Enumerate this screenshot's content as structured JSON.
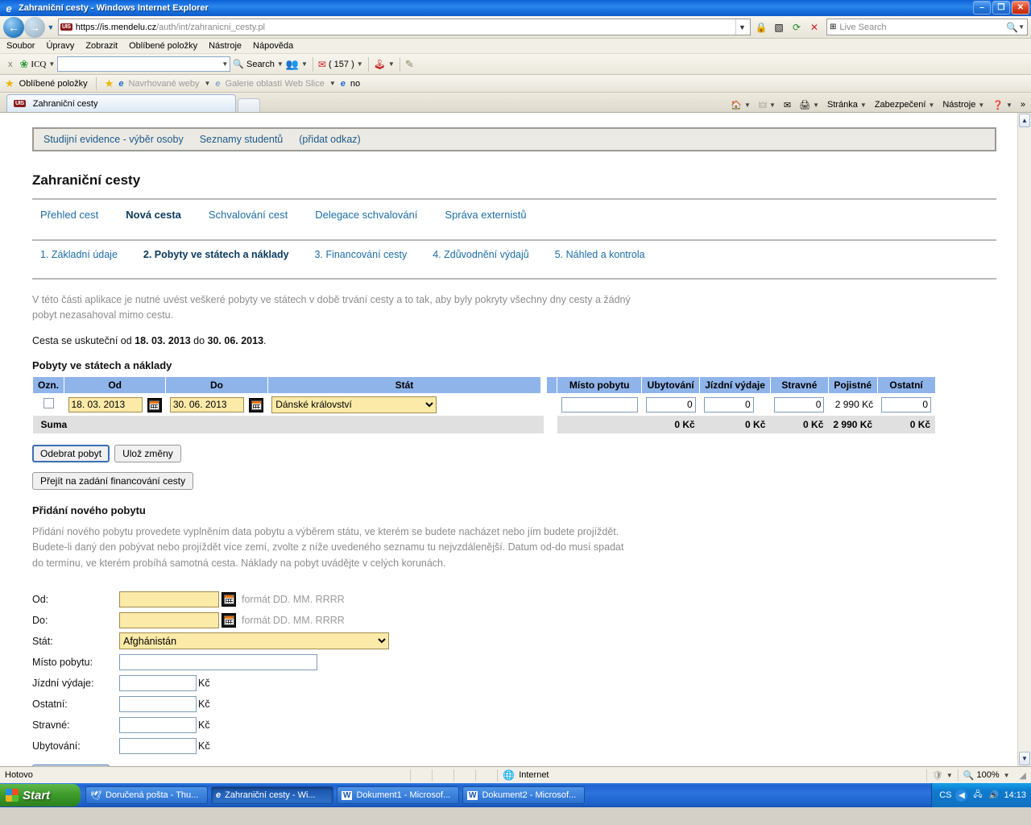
{
  "window": {
    "title": "Zahraniční cesty - Windows Internet Explorer",
    "minimize_label": "–",
    "maximize_label": "❐",
    "close_label": "✕"
  },
  "browser": {
    "url_protocol": "https://",
    "url_host": "is.mendelu.cz",
    "url_path": "/auth/int/zahranicni_cesty.pl",
    "url_badge": "UIS",
    "search_placeholder": "Live Search",
    "menu": [
      "Soubor",
      "Úpravy",
      "Zobrazit",
      "Oblíbené položky",
      "Nástroje",
      "Nápověda"
    ],
    "icq_toolbar": {
      "close_label": "x",
      "brand": "ICQ",
      "search_label": "Search",
      "mail_count": "( 157 )"
    },
    "favorites_bar": {
      "favorites_label": "Oblíbené položky",
      "suggested_sites": "Navrhované weby",
      "web_slice_gallery": "Galerie oblastí Web Slice",
      "link_no": "no"
    },
    "tab_title": "Zahraniční cesty",
    "command_bar": [
      "Stránka",
      "Zabezpečení",
      "Nástroje"
    ],
    "overflow_label": "»"
  },
  "site": {
    "breadcrumb": [
      "Studijní evidence - výběr osoby",
      "Seznamy studentů",
      "(přidat odkaz)"
    ],
    "page_title": "Zahraniční cesty",
    "main_tabs": [
      {
        "label": "Přehled cest",
        "active": false
      },
      {
        "label": "Nová cesta",
        "active": true
      },
      {
        "label": "Schvalování cest",
        "active": false
      },
      {
        "label": "Delegace schvalování",
        "active": false
      },
      {
        "label": "Správa externistů",
        "active": false
      }
    ],
    "steps": [
      {
        "label": "1. Základní údaje",
        "active": false
      },
      {
        "label": "2. Pobyty ve státech a náklady",
        "active": true
      },
      {
        "label": "3. Financování cesty",
        "active": false
      },
      {
        "label": "4. Zdůvodnění výdajů",
        "active": false
      },
      {
        "label": "5. Náhled a kontrola",
        "active": false
      }
    ],
    "intro_text": "V této části aplikace je nutné uvést veškeré pobyty ve státech v době trvání cesty a to tak, aby byly pokryty všechny dny cesty a žádný pobyt nezasahoval mimo cestu.",
    "trip_dates": {
      "prefix": "Cesta se uskuteční od ",
      "from": "18. 03. 2013",
      "middle": " do ",
      "to": "30. 06. 2013",
      "suffix": "."
    },
    "table_heading": "Pobyty ve státech a náklady",
    "table": {
      "headers": [
        "Ozn.",
        "Od",
        "Do",
        "Stát",
        "Místo pobytu",
        "Ubytování",
        "Jízdní výdaje",
        "Stravné",
        "Pojistné",
        "Ostatní"
      ],
      "rows": [
        {
          "checked": false,
          "od": "18. 03. 2013",
          "do": "30. 06. 2013",
          "stat": "Dánské království",
          "misto_pobytu": "",
          "ubytovani": "0",
          "jizdni_vydaje": "0",
          "stravne": "0",
          "pojistne": "2 990 Kč",
          "ostatni": "0"
        }
      ],
      "sum_row": {
        "label": "Suma",
        "misto_pobytu": "",
        "ubytovani": "0 Kč",
        "jizdni_vydaje": "0 Kč",
        "stravne": "0 Kč",
        "pojistne": "2 990 Kč",
        "ostatni": "0 Kč"
      }
    },
    "buttons": {
      "remove_stay": "Odebrat pobyt",
      "save_changes": "Ulož změny",
      "go_to_financing": "Přejít na zadání financování cesty"
    },
    "add_section": {
      "heading": "Přidání nového pobytu",
      "description": "Přidání nového pobytu provedete vyplněním data pobytu a výběrem státu, ve kterém se budete nacházet nebo jím budete projíždět. Budete-li daný den pobývat nebo projíždět více zemí, zvolte z níže uvedeného seznamu tu nejvzdálenější. Datum od-do musí spadat do termínu, ve kterém probíhá samotná cesta. Náklady na pobyt uvádějte v celých korunách.",
      "fields": [
        {
          "label": "Od:",
          "value": "",
          "hint": "formát DD. MM. RRRR",
          "type": "date"
        },
        {
          "label": "Do:",
          "value": "",
          "hint": "formát DD. MM. RRRR",
          "type": "date"
        },
        {
          "label": "Stát:",
          "value": "Afghánistán",
          "hint": "",
          "type": "select"
        },
        {
          "label": "Místo pobytu:",
          "value": "",
          "hint": "",
          "type": "text"
        },
        {
          "label": "Jízdní výdaje:",
          "value": "",
          "hint": "Kč",
          "type": "money"
        },
        {
          "label": "Ostatní:",
          "value": "",
          "hint": "Kč",
          "type": "money"
        },
        {
          "label": "Stravné:",
          "value": "",
          "hint": "Kč",
          "type": "money"
        },
        {
          "label": "Ubytování:",
          "value": "",
          "hint": "Kč",
          "type": "money"
        }
      ]
    }
  },
  "statusbar": {
    "status_text": "Hotovo",
    "zone_label": "Internet",
    "zoom_level": "100%"
  },
  "taskbar": {
    "start_label": "Start",
    "tasks": [
      {
        "label": "Doručená pošta - Thu...",
        "active": false
      },
      {
        "label": "Zahraniční cesty - Wi...",
        "active": true
      },
      {
        "label": "Dokument1 - Microsof...",
        "active": false
      },
      {
        "label": "Dokument2 - Microsof...",
        "active": false
      }
    ],
    "language": "CS",
    "clock": "14:13"
  },
  "colors": {
    "table_header": "#8fb4ea",
    "link": "#1c6ea8",
    "input_highlight": "#fbeaa8",
    "sum_row": "#e0e0e0"
  }
}
